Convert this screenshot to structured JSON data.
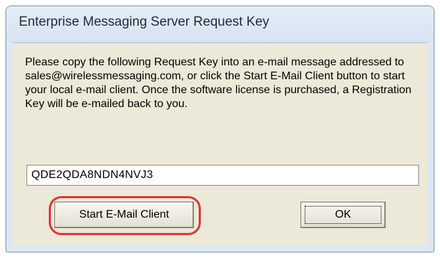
{
  "window": {
    "title": "Enterprise Messaging Server Request Key"
  },
  "dialog": {
    "message": "Please copy the following Request Key into an e-mail message addressed to sales@wirelessmessaging.com, or click the Start E-Mail Client button to start your local e-mail client. Once the software license is purchased, a Registration Key will be e-mailed back to you.",
    "request_key": "QDE2QDA8NDN4NVJ3",
    "start_email_label": "Start E-Mail Client",
    "ok_label": "OK"
  },
  "colors": {
    "highlight": "#e23434",
    "dialog_face": "#ece9d8",
    "frame": "#dce7f3"
  }
}
